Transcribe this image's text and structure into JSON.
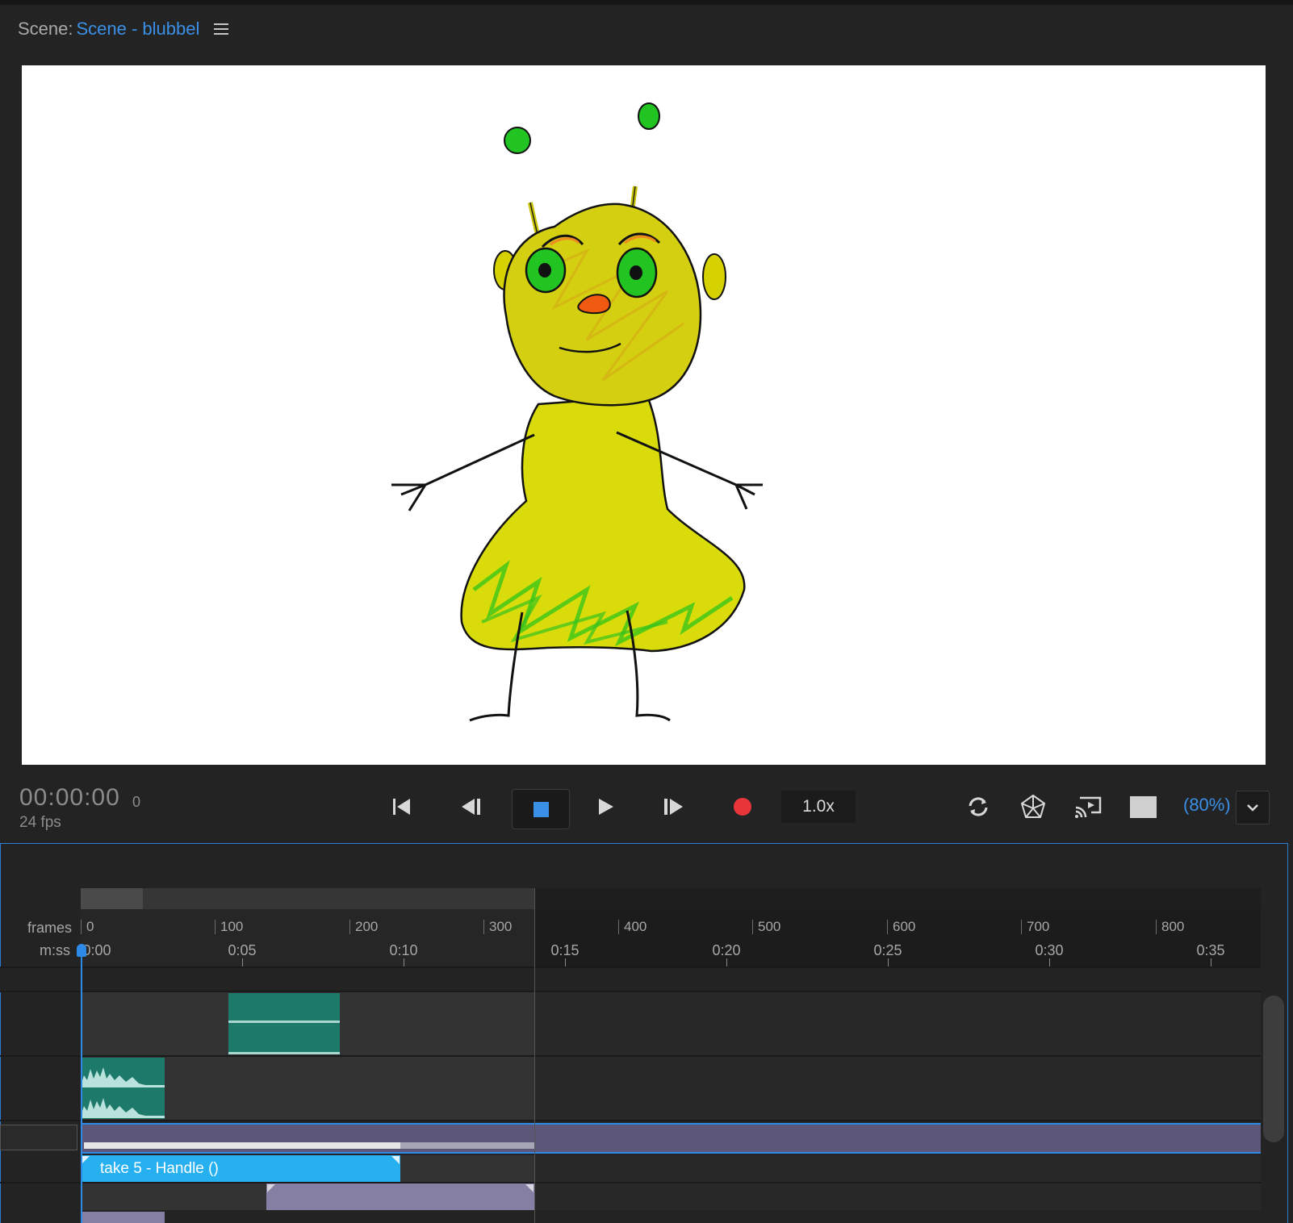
{
  "scene": {
    "label": "Scene:",
    "name": "Scene - blubbel"
  },
  "transport": {
    "timecode": "00:00:00",
    "frame": "0",
    "fps": "24 fps",
    "speed": "1.0x",
    "zoom": "(80%)"
  },
  "icons": {
    "menu": "hamburger-menu-icon",
    "go_start": "skip-to-start-icon",
    "step_back": "step-back-icon",
    "stop": "stop-icon",
    "play": "play-icon",
    "step_forward": "step-forward-icon",
    "record": "record-icon",
    "loop": "loop-icon",
    "puppet": "puppet-mesh-icon",
    "cast": "cast-screen-icon",
    "background": "background-color-swatch",
    "dropdown": "chevron-down-icon"
  },
  "colors": {
    "accent": "#3a8fe6",
    "record": "#e8363b",
    "clip_green": "#1d7a6a",
    "clip_blue": "#27b0f0",
    "clip_purple": "#857fa3"
  },
  "timeline": {
    "frames_label": "frames",
    "time_label": "m:ss",
    "frame_ticks": [
      "0",
      "100",
      "200",
      "300",
      "400",
      "500",
      "600",
      "700",
      "800"
    ],
    "time_ticks": [
      "0:00",
      "0:05",
      "0:10",
      "0:15",
      "0:20",
      "0:25",
      "0:30",
      "0:35"
    ],
    "handle_clip_label": "take 5 - Handle ()"
  }
}
